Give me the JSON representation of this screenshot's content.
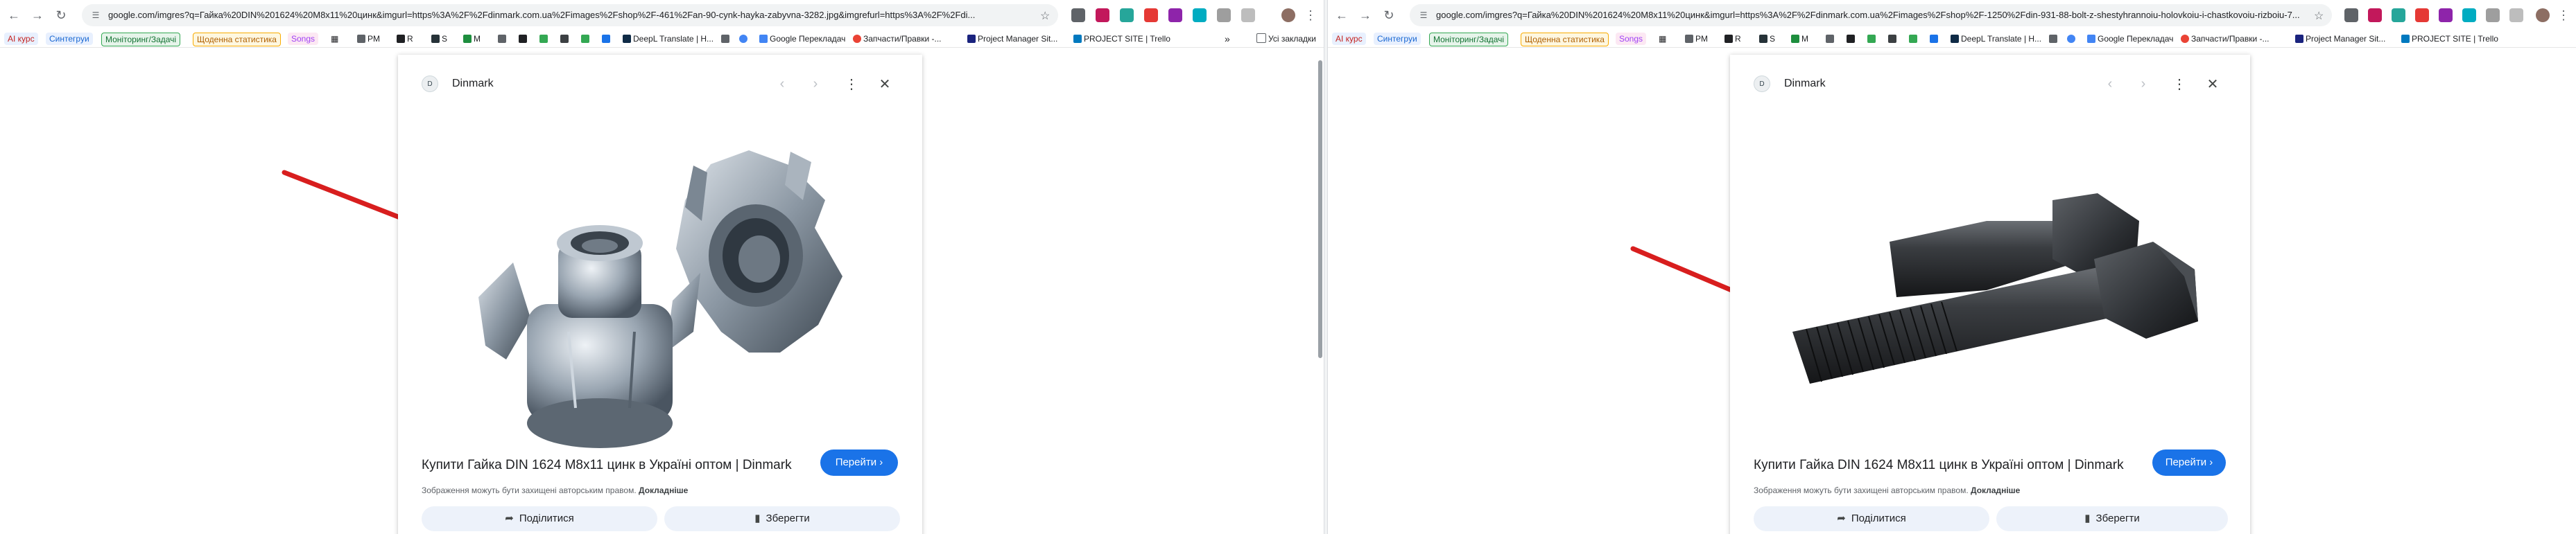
{
  "left": {
    "url": "google.com/imgres?q=Гайка%20DIN%201624%20M8x11%20цинк&imgurl=https%3A%2F%2Fdinmark.com.ua%2Fimages%2Fshop%2F-461%2Fan-90-cynk-hayka-zabyvna-3282.jpg&imgrefurl=https%3A%2F%2Fdi...",
    "source_name": "Dinmark",
    "favicon_text": "D",
    "caption": "Купити Гайка DIN 1624 M8x11 цинк в Україні оптом | Dinmark",
    "visit_label": "Перейти",
    "copyright_text": "Зображення можуть бути захищені авторським правом.",
    "more_link": "Докладніше",
    "share_label": "Поділитися",
    "save_label": "Зберегти"
  },
  "right": {
    "url": "google.com/imgres?q=Гайка%20DIN%201624%20M8x11%20цинк&imgurl=https%3A%2F%2Fdinmark.com.ua%2Fimages%2Fshop%2F-1250%2Fdin-931-88-bolt-z-shestyhrannoiu-holovkoiu-i-chastkovoiu-rizboiu-7...",
    "source_name": "Dinmark",
    "favicon_text": "D",
    "caption": "Купити Гайка DIN 1624 M8x11 цинк в Україні оптом | Dinmark",
    "visit_label": "Перейти",
    "copyright_text": "Зображення можуть бути захищені авторським правом.",
    "more_link": "Докладніше",
    "share_label": "Поділитися",
    "save_label": "Зберегти"
  },
  "bookmarks": {
    "ai_course": "AI курс",
    "synergy": "Синтегруи",
    "monitoring": "Моніторинг/Задачі",
    "daily_stats": "Щоденна статистика",
    "songs": "Songs",
    "pm": "PM",
    "r": "R",
    "s": "S",
    "m": "M",
    "deepl": "DeepL Translate | Н...",
    "google_translate": "Google Перекладач",
    "spare_parts": "Запчасти/Правки -...",
    "project_manager": "Project Manager Sit...",
    "project_site": "PROJECT SITE | Trello",
    "all_bookmarks": "Усі закладки",
    "more": "»"
  },
  "colors": {
    "accent": "#1a73e8",
    "arrow": "#d81e1e",
    "chip_ai": "#e8f0fe",
    "chip_synergy": "#fce8e6",
    "chip_monitoring": "#e6f4ea",
    "chip_daily": "#fef7e0",
    "chip_songs": "#fce8f3"
  },
  "icons": {
    "back": "arrow-left-icon",
    "forward": "arrow-right-icon",
    "reload": "reload-icon",
    "site_info": "tune-icon",
    "star": "star-icon",
    "more": "more-vert-icon",
    "close": "close-icon",
    "share": "share-icon",
    "bookmark": "bookmark-icon",
    "prev": "chevron-left-icon",
    "next": "chevron-right-icon"
  }
}
